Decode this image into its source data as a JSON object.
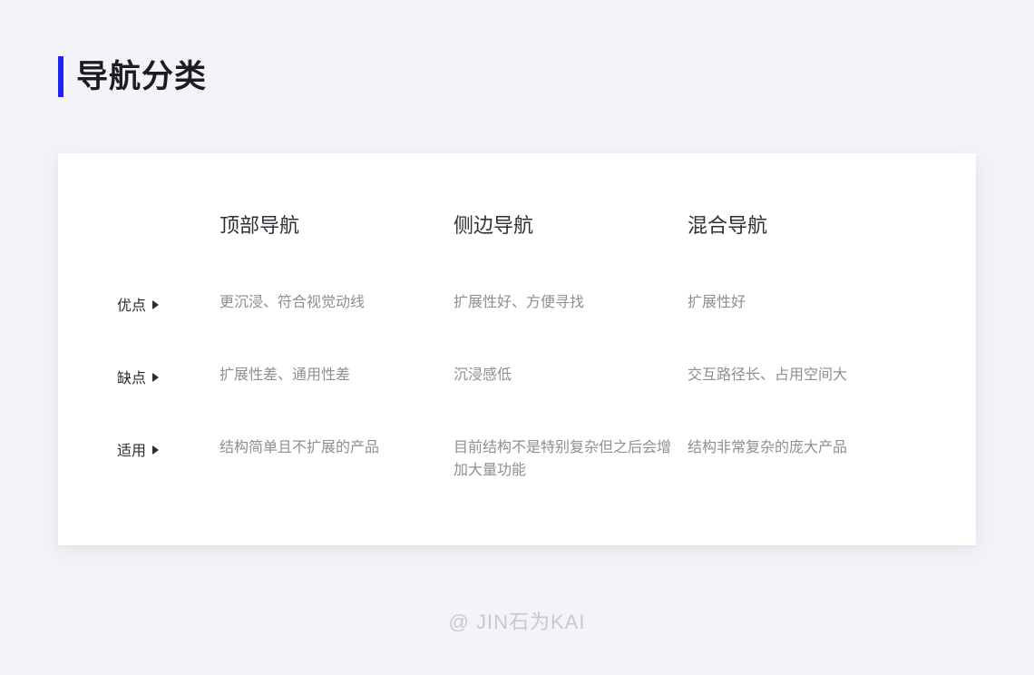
{
  "page": {
    "title": "导航分类",
    "accent_color": "#1f22f0",
    "background_color": "#f3f4f8",
    "card_color": "#ffffff"
  },
  "table": {
    "corner_label": "",
    "columns": [
      {
        "label": "顶部导航"
      },
      {
        "label": "侧边导航"
      },
      {
        "label": "混合导航"
      }
    ],
    "rows": [
      {
        "label": "优点",
        "marker": "caret-right-icon",
        "cells": [
          "更沉浸、符合视觉动线",
          "扩展性好、方便寻找",
          "扩展性好"
        ]
      },
      {
        "label": "缺点",
        "marker": "caret-right-icon",
        "cells": [
          "扩展性差、通用性差",
          "沉浸感低",
          "交互路径长、占用空间大"
        ]
      },
      {
        "label": "适用",
        "marker": "caret-right-icon",
        "cells": [
          "结构简单且不扩展的产品",
          "目前结构不是特别复杂但之后会增加大量功能",
          "结构非常复杂的庞大产品"
        ]
      }
    ]
  },
  "footer": {
    "credit": "@ JIN石为KAI"
  }
}
